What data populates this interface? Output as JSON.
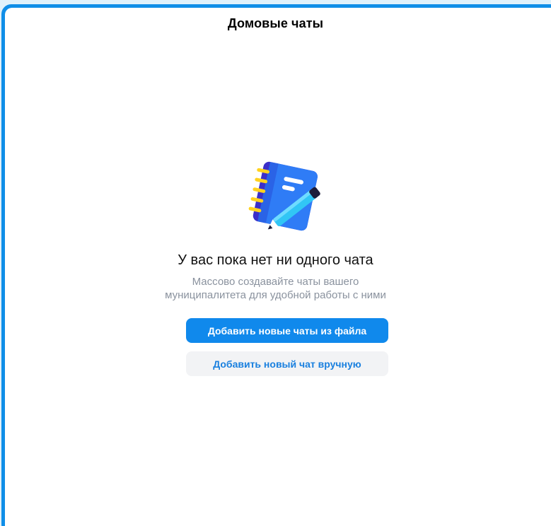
{
  "header": {
    "title": "Домовые чаты"
  },
  "empty_state": {
    "illustration_icon": "notebook-pencil-icon",
    "heading": "У вас пока нет ни одного чата",
    "subtitle_line1": "Массово создавайте чаты вашего",
    "subtitle_line2": "муниципалитета для удобной работы с ними"
  },
  "actions": {
    "import_label": "Добавить новые чаты из файла",
    "manual_label": "Добавить новый чат вручную"
  },
  "colors": {
    "accent": "#1089ec",
    "frame": "#0f8ee8",
    "secondary_bg": "#f2f3f5",
    "muted_text": "#8a929e"
  }
}
